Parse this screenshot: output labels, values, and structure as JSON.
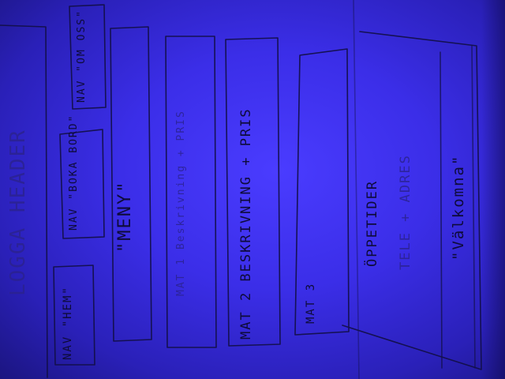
{
  "sketch": {
    "header": "LOGGA HEADER",
    "nav_home": "NAV \"HEM\"",
    "nav_book": "NAV \"BOKA BORD\"",
    "nav_about": "NAV \"OM OSS\"",
    "menu_title": "\"MENY\"",
    "dish1": "MAT 1 Beskrivning + PRIS",
    "dish2": "MAT 2 BESKRIVNING + PRIS",
    "dish3": "MAT 3",
    "hours": "ÖPPETIDER",
    "contact": "TELE + ADRES",
    "welcome": "\"Välkomna\""
  },
  "colors": {
    "paper": "#3b2ee8",
    "ink": "#0e0b3a"
  }
}
